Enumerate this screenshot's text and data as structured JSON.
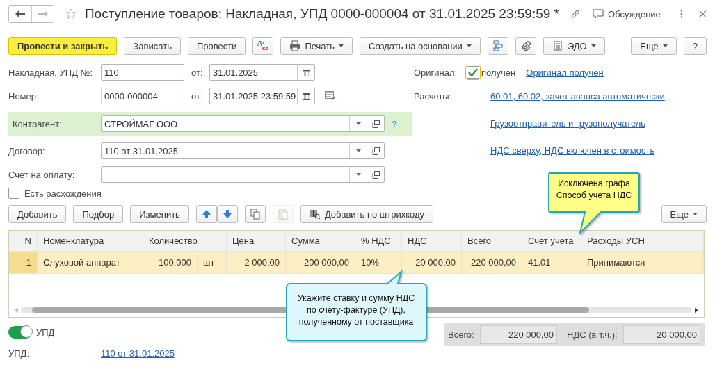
{
  "window": {
    "title": "Поступление товаров: Накладная, УПД 0000-000004 от 31.01.2025 23:59:59 *",
    "discussion": "Обсуждение"
  },
  "toolbar": [
    {
      "kind": "primary",
      "label": "Провести и закрыть"
    },
    {
      "kind": "button",
      "label": "Записать"
    },
    {
      "kind": "button",
      "label": "Провести"
    },
    {
      "kind": "dtkt",
      "dt": "Дт",
      "kt": "Кт"
    },
    {
      "kind": "menu",
      "label": "Печать"
    },
    {
      "kind": "menu",
      "label": "Создать на основании"
    },
    {
      "kind": "icon"
    },
    {
      "kind": "icon"
    },
    {
      "kind": "menu",
      "label": "ЭДО"
    }
  ],
  "toolbar_right": [
    {
      "kind": "menu",
      "label": "Еще"
    },
    {
      "kind": "button",
      "label": "?"
    }
  ],
  "invoice": {
    "label": "Накладная, УПД №:",
    "value": "110",
    "date_label": "от:",
    "date": "31.01.2025"
  },
  "number": {
    "label": "Номер:",
    "value": "0000-000004",
    "date_label": "от:",
    "date": "31.01.2025 23:59:59"
  },
  "counterparty": {
    "label": "Контрагент:",
    "value": "СТРОЙМАГ ООО",
    "help": "?"
  },
  "contract": {
    "label": "Договор:",
    "value": "110 от 31.01.2025"
  },
  "payment_invoice": {
    "label": "Счет на оплату:"
  },
  "discrepancies": {
    "label": "Есть расхождения",
    "checked": false
  },
  "original": {
    "label": "Оригинал:",
    "checked": true,
    "caption": "получен",
    "link": "Оригинал получен"
  },
  "settlements": {
    "label": "Расчеты:",
    "link": "60.01, 60.02, зачет аванса автоматически"
  },
  "links": [
    "Грузоотправитель и грузополучатель",
    "НДС сверху, НДС включен в стоимость"
  ],
  "table_toolbar": [
    {
      "kind": "button",
      "label": "Добавить"
    },
    {
      "kind": "button",
      "label": "Подбор"
    },
    {
      "kind": "button",
      "label": "Изменить"
    },
    {
      "kind": "icon",
      "disabled": false
    },
    {
      "kind": "icon",
      "disabled": false
    },
    {
      "kind": "icon",
      "disabled": false
    },
    {
      "kind": "icon",
      "disabled": true
    },
    {
      "kind": "barcode",
      "label": "Добавить по штрихкоду"
    }
  ],
  "table_toolbar_right": {
    "label": "Еще"
  },
  "table": {
    "columns": [
      {
        "label": "N"
      },
      {
        "label": "Номенклатура"
      },
      {
        "label": "Количество"
      },
      {
        "label": "Цена"
      },
      {
        "label": "Сумма"
      },
      {
        "label": "% НДС"
      },
      {
        "label": "НДС"
      },
      {
        "label": "Всего"
      },
      {
        "label": "Счет учета"
      },
      {
        "label": "Расходы УСН"
      }
    ],
    "rows": [
      {
        "selected": true,
        "unit": "шт",
        "cells": [
          "1",
          "Слуховой аппарат",
          "100,000",
          "2 000,00",
          "200 000,00",
          "10%",
          "20 000,00",
          "220 000,00",
          "41.01",
          "Принимаются"
        ]
      }
    ]
  },
  "upd_switch": {
    "label": "УПД",
    "on": true
  },
  "upd": {
    "label": "УПД:",
    "link": "110 от 31.01.2025"
  },
  "totals": [
    {
      "label": "Всего:",
      "value": "220 000,00"
    },
    {
      "label": "НДС (в т.ч.):",
      "value": "20 000,00"
    }
  ],
  "callouts": [
    {
      "text": "Исключена графа\nСпособ учета НДС",
      "color": "#ffff88"
    },
    {
      "text": "Укажите ставку и сумму НДС\nпо счету-фактуре (УПД),\nполученному от поставщика",
      "color": "#ddf7fc"
    }
  ]
}
